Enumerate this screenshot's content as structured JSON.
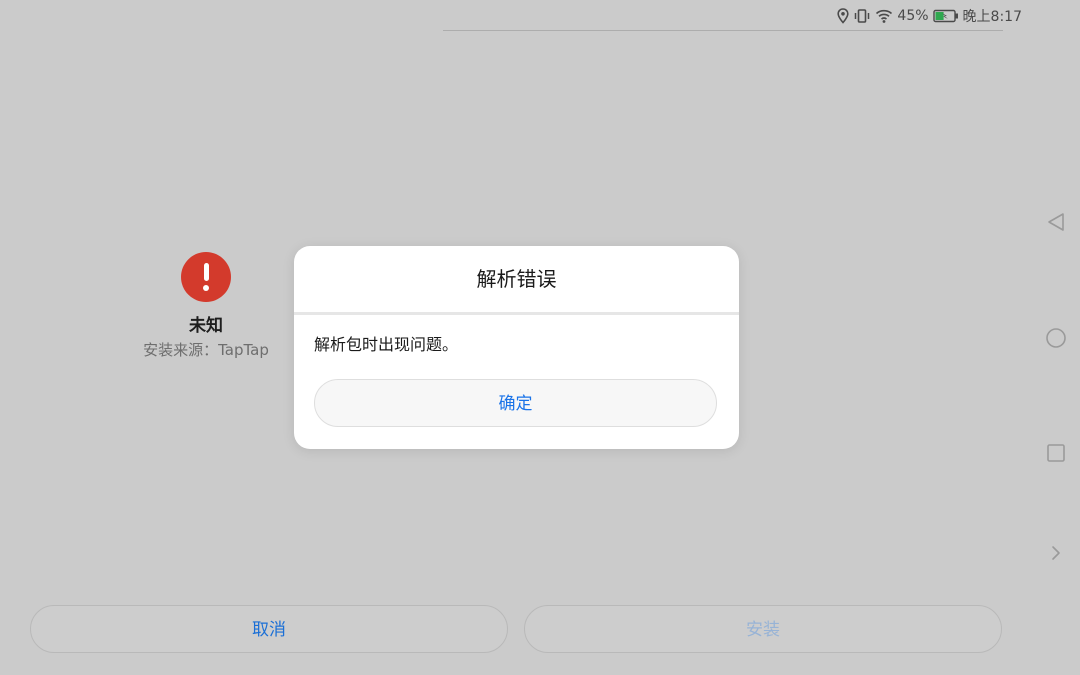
{
  "status_bar": {
    "battery_percent": "45%",
    "time": "晚上8:17",
    "icons": [
      "location-icon",
      "vibrate-icon",
      "wifi-icon",
      "battery-charging-icon"
    ],
    "battery_level": 0.45,
    "battery_color": "#2fa84f"
  },
  "app": {
    "name": "未知",
    "source": "安装来源：TapTap",
    "icon": "warning-icon",
    "icon_color": "#d33a2c"
  },
  "dialog": {
    "title": "解析错误",
    "message": "解析包时出现问题。",
    "ok_label": "确定"
  },
  "actions": {
    "cancel_label": "取消",
    "install_label": "安装",
    "accent_color": "#1a73e8",
    "disabled_color": "#97b3d6"
  },
  "nav_bar": {
    "items": [
      "back-icon",
      "home-icon",
      "recents-icon",
      "expand-icon"
    ]
  }
}
